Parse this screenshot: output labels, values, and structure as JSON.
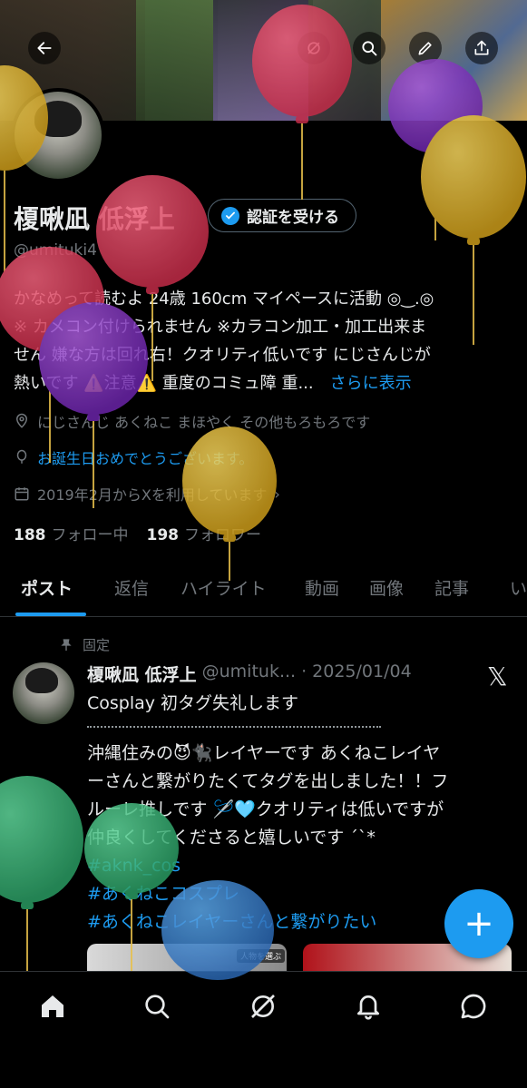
{
  "profile": {
    "name": "榎啾凪 低浮上",
    "handle": "@umituki4",
    "verify_label": "認証を受ける",
    "bio_line1": "かなめって読むよ 24歳 160cm マイペースに活動 ◎‿.◎",
    "bio_line2": "※ カメコン付けられません ※カラコン加工・加工出来ま",
    "bio_line3": "せん 嫌な方は回れ右！クオリティ低いです にじさんじが",
    "bio_line4": "熱いです ⚠️注意⚠️ 重度のコミュ障 重...",
    "bio_more": "さらに表示",
    "location": "にじさんじ あくねこ まほやく その他もろもろです",
    "birthday": "お誕生日おめでとうございます。",
    "joined": "2019年2月からXを利用しています",
    "following_count": "188",
    "following_label": "フォロー中",
    "followers_count": "198",
    "followers_label": "フォロワー"
  },
  "tabs": [
    "ポスト",
    "返信",
    "ハイライト",
    "動画",
    "画像",
    "記事",
    "い"
  ],
  "post": {
    "pinned_label": "固定",
    "author_name": "榎啾凪 低浮上",
    "author_handle": "@umituk...",
    "date": "· 2025/01/04",
    "title": "Cosplay 初タグ失礼します",
    "body_line1": "沖縄住みの😈🐈‍⬛レイヤーです あくねこレイヤ",
    "body_line2": "ーさんと繋がりたくてタグを出しました！！フ",
    "body_line3": "ルーレ推しです 🪡🩵クオリティは低いですが",
    "body_line4": "仲良くしてくださると嬉しいです ´`*",
    "tag1": "#aknk_cos",
    "tag2": "#あくねこコスプレ",
    "tag3": "#あくねこレイヤーさんと繋がりたい",
    "media_badge": "人物を選ぶ"
  },
  "fab_label": "+",
  "colors": {
    "accent": "#1d9bf0",
    "background": "#000000",
    "muted": "#71767b",
    "text": "#e7e9ea"
  },
  "icons": {
    "back": "arrow-left-icon",
    "grok": "grok-icon",
    "search": "search-icon",
    "edit": "pencil-icon",
    "share": "share-icon",
    "home": "home-icon",
    "explore": "search-icon",
    "notifications": "bell-icon",
    "messages": "chat-bubble-icon"
  }
}
